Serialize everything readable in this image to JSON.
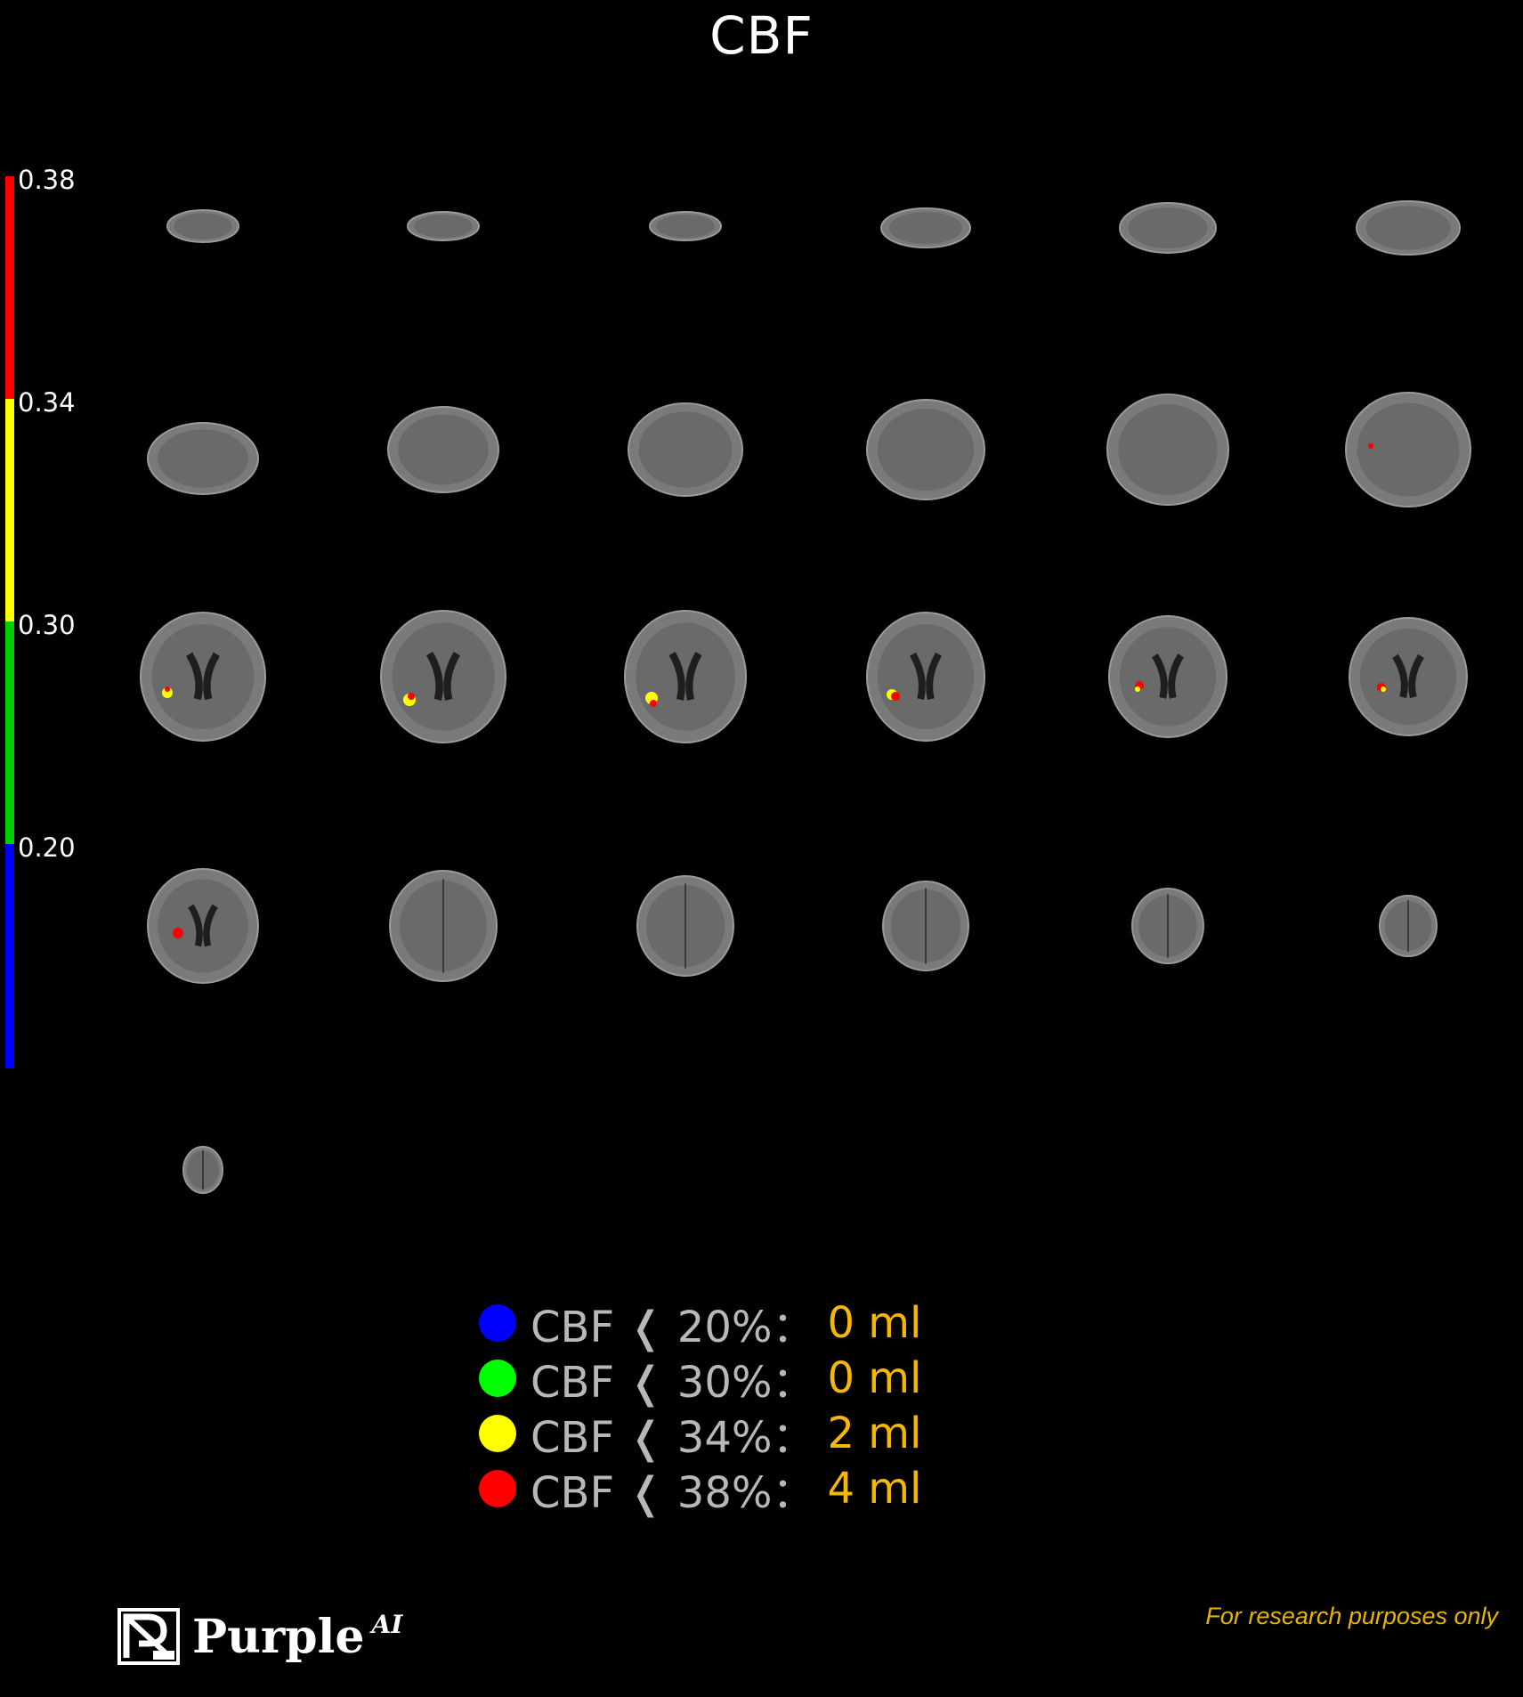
{
  "title": "CBF",
  "scale": {
    "ticks": [
      "0.38",
      "0.34",
      "0.30",
      "0.20"
    ],
    "colors": [
      "#ff0000",
      "#ffff00",
      "#00d000",
      "#0000ff"
    ]
  },
  "legend": [
    {
      "color": "#0000ff",
      "label": "CBF ❬ 20%：",
      "volume": "0 ml"
    },
    {
      "color": "#00ff00",
      "label": "CBF ❬ 30%：",
      "volume": "0 ml"
    },
    {
      "color": "#ffff00",
      "label": "CBF ❬ 34%：",
      "volume": "2 ml"
    },
    {
      "color": "#ff0000",
      "label": "CBF ❬ 38%：",
      "volume": "4 ml"
    }
  ],
  "brand": {
    "name": "Purple",
    "suffix": "AI"
  },
  "disclaimer": "For research purposes only"
}
